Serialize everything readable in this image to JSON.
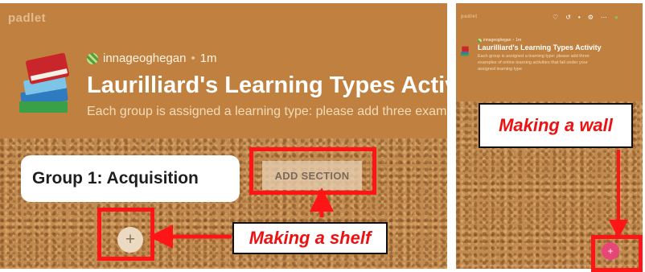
{
  "left_panel": {
    "brand": "padlet",
    "author": "innageoghegan",
    "separator": "•",
    "time_ago": "1m",
    "title": "Laurilliard's Learning Types Activity",
    "description": "Each group is assigned a learning type: please add three examples o",
    "section_title": "Group 1: Acquisition",
    "kebab_label": "⋮",
    "add_section_label": "ADD SECTION",
    "add_post_label": "+",
    "callout": "Making a shelf"
  },
  "right_panel": {
    "brand": "padlet",
    "toolbar_icons": [
      "♡",
      "↺",
      "•",
      "⚙",
      "⋯",
      "●"
    ],
    "author": "innageoghegan",
    "separator": "•",
    "time_ago": "1m",
    "title": "Laurilliard's Learning Types Activity",
    "description": "Each group is assigned a learning type: please add three examples of online learning activities that fall under your assigned learning type",
    "add_post_label": "+",
    "callout": "Making a wall"
  },
  "colors": {
    "header_bg": "#c0803f",
    "cork": "#c18a4f",
    "highlight_red": "#ff1515",
    "callout_text": "#ee1111",
    "wall_add_button": "#e8457a"
  }
}
